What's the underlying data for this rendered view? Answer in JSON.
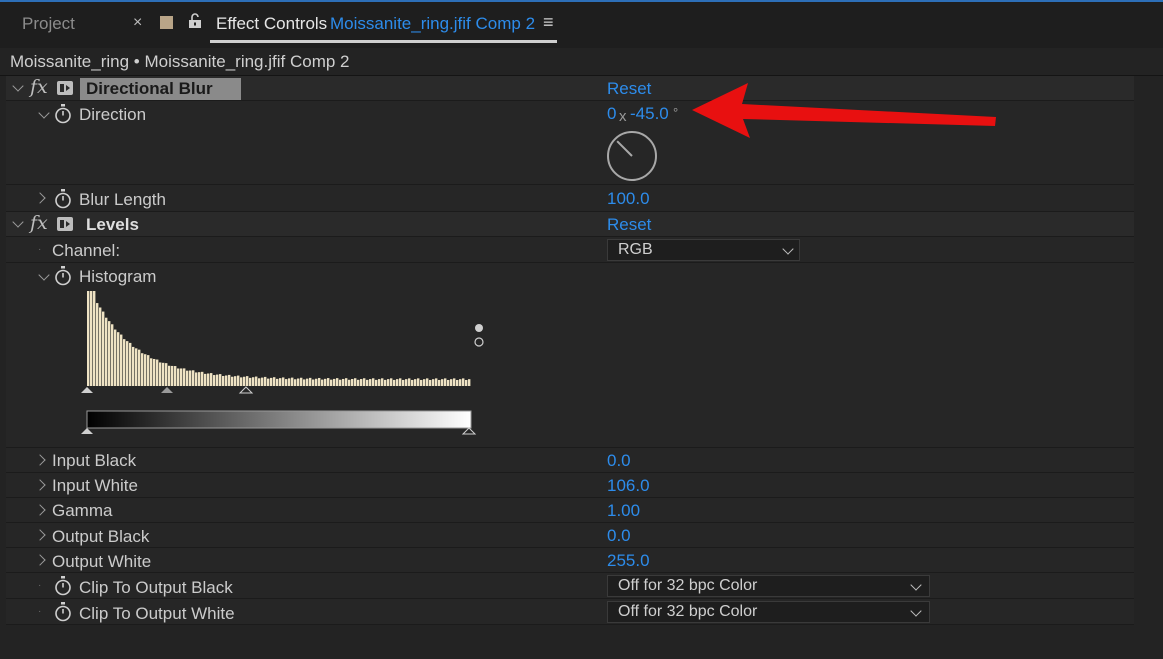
{
  "tabs": {
    "project": "Project",
    "close": "×",
    "effect_controls": "Effect Controls",
    "comp": "Moissanite_ring.jfif Comp 2",
    "menu": "≡"
  },
  "layer_title": "Moissanite_ring • Moissanite_ring.jfif Comp 2",
  "directional_blur": {
    "name": "Directional Blur",
    "reset": "Reset",
    "direction_label": "Direction",
    "direction_revs": "0",
    "direction_x": "x",
    "direction_deg": "-45.0",
    "direction_unit": "°",
    "direction_angle_deg": -45,
    "blur_length_label": "Blur Length",
    "blur_length_value": "100.0"
  },
  "levels": {
    "name": "Levels",
    "reset": "Reset",
    "channel_label": "Channel:",
    "channel_value": "RGB",
    "histogram_label": "Histogram",
    "input_black_label": "Input Black",
    "input_black_value": "0.0",
    "input_white_label": "Input White",
    "input_white_value": "106.0",
    "gamma_label": "Gamma",
    "gamma_value": "1.00",
    "output_black_label": "Output Black",
    "output_black_value": "0.0",
    "output_white_label": "Output White",
    "output_white_value": "255.0",
    "clip_black_label": "Clip To Output Black",
    "clip_black_value": "Off for 32 bpc Color",
    "clip_white_label": "Clip To Output White",
    "clip_white_value": "Off for 32 bpc Color"
  },
  "colors": {
    "accent": "#2d8ceb",
    "annotation_arrow": "#e81010"
  }
}
